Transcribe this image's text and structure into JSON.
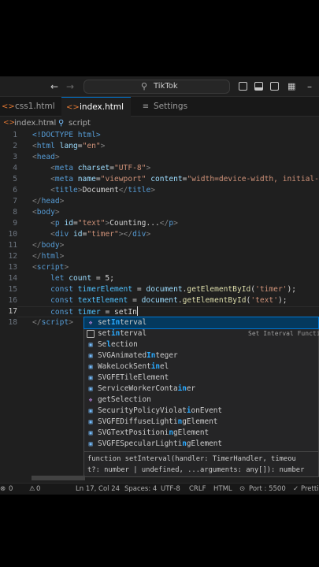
{
  "titlebar": {
    "search_text": "TikTok",
    "icons": [
      "arrow-left",
      "arrow-right",
      "search",
      "toggle-primary-sidebar",
      "toggle-panel",
      "toggle-secondary-sidebar",
      "customize-layout"
    ]
  },
  "tabs": [
    {
      "label": "css1.html",
      "icon": "html-file",
      "active": false
    },
    {
      "label": "index.html",
      "icon": "html-file",
      "active": true
    },
    {
      "label": "Settings",
      "icon": "settings-lines",
      "active": false
    }
  ],
  "breadcrumb": {
    "file": "index.html",
    "symbol": "script"
  },
  "editor": {
    "current_line": 17,
    "lines": [
      {
        "n": "1"
      },
      {
        "n": "2"
      },
      {
        "n": "3"
      },
      {
        "n": "4"
      },
      {
        "n": "5"
      },
      {
        "n": "6"
      },
      {
        "n": "7"
      },
      {
        "n": "8"
      },
      {
        "n": "9"
      },
      {
        "n": "10"
      },
      {
        "n": "11"
      },
      {
        "n": "12"
      },
      {
        "n": "13"
      },
      {
        "n": "14"
      },
      {
        "n": "15"
      },
      {
        "n": "16"
      },
      {
        "n": "17"
      },
      {
        "n": "18"
      }
    ],
    "code": {
      "l1": "<!DOCTYPE html>",
      "l2_tag": "html",
      "l2_attr": "lang",
      "l2_val": "\"en\"",
      "l3_tag": "head",
      "l4_tag": "meta",
      "l4_attr": "charset",
      "l4_val": "\"UTF-8\"",
      "l5_tag": "meta",
      "l5_attr1": "name",
      "l5_val1": "\"viewport\"",
      "l5_attr2": "content",
      "l5_val2": "\"width=device-width, initial-",
      "l6_tag": "title",
      "l6_text": "Document",
      "l7_tag": "head",
      "l8_tag": "body",
      "l9_tag": "p",
      "l9_attr": "id",
      "l9_val": "\"text\"",
      "l9_text": "Counting...",
      "l10_tag": "div",
      "l10_attr": "id",
      "l10_val": "\"timer\"",
      "l11_tag": "body",
      "l12_tag": "html",
      "l13_tag": "script",
      "l14_kw": "let",
      "l14_var": "count",
      "l14_rest": " = 5;",
      "l15_kw": "const",
      "l15_var": "timerElement",
      "l15_obj": "document",
      "l15_fn": "getElementById",
      "l15_str": "'timer'",
      "l16_kw": "const",
      "l16_var": "textElement",
      "l16_obj": "document",
      "l16_fn": "getElementById",
      "l16_str": "'text'",
      "l17_kw": "const",
      "l17_var": "timer",
      "l17_typed": "setIn",
      "l18_tag": "script"
    }
  },
  "suggestions": [
    {
      "pre": "set",
      "hi": "In",
      "post": "terval",
      "icon": "method",
      "selected": true
    },
    {
      "pre": "set",
      "hi": "in",
      "post": "terval",
      "icon": "snippet",
      "detail": "Set Interval Functi"
    },
    {
      "pre": "Se",
      "hi": "l",
      "post": "ection",
      "icon": "class"
    },
    {
      "pre": "SVGAnimated",
      "hi": "In",
      "post": "teger",
      "icon": "class"
    },
    {
      "pre": "WakeLockSent",
      "hi": "in",
      "post": "el",
      "icon": "class"
    },
    {
      "pre": "SVGFETileElement",
      "hi": "",
      "post": "",
      "icon": "class"
    },
    {
      "pre": "ServiceWorkerConta",
      "hi": "in",
      "post": "er",
      "icon": "class"
    },
    {
      "pre": "getSelection",
      "hi": "",
      "post": "",
      "icon": "method"
    },
    {
      "pre": "SecurityPolicyViolat",
      "hi": "i",
      "post": "onEvent",
      "icon": "class"
    },
    {
      "pre": "SVGFEDiffuseLighti",
      "hi": "n",
      "post": "gElement",
      "icon": "class"
    },
    {
      "pre": "SVGTextPositioni",
      "hi": "n",
      "post": "gElement",
      "icon": "class"
    },
    {
      "pre": "SVGFESpecularLighti",
      "hi": "n",
      "post": "gElement",
      "icon": "class"
    }
  ],
  "suggest_doc": {
    "line1": "function setInterval(handler: TimerHandler, timeou",
    "line2": "t?: number | undefined, ...arguments: any[]): number"
  },
  "statusbar": {
    "errors": "0",
    "warnings": "0",
    "position": "Ln 17, Col 24",
    "spaces": "Spaces: 4",
    "encoding": "UTF-8",
    "eol": "CRLF",
    "language": "HTML",
    "port": "Port : 5500",
    "prettier": "Prettie"
  }
}
